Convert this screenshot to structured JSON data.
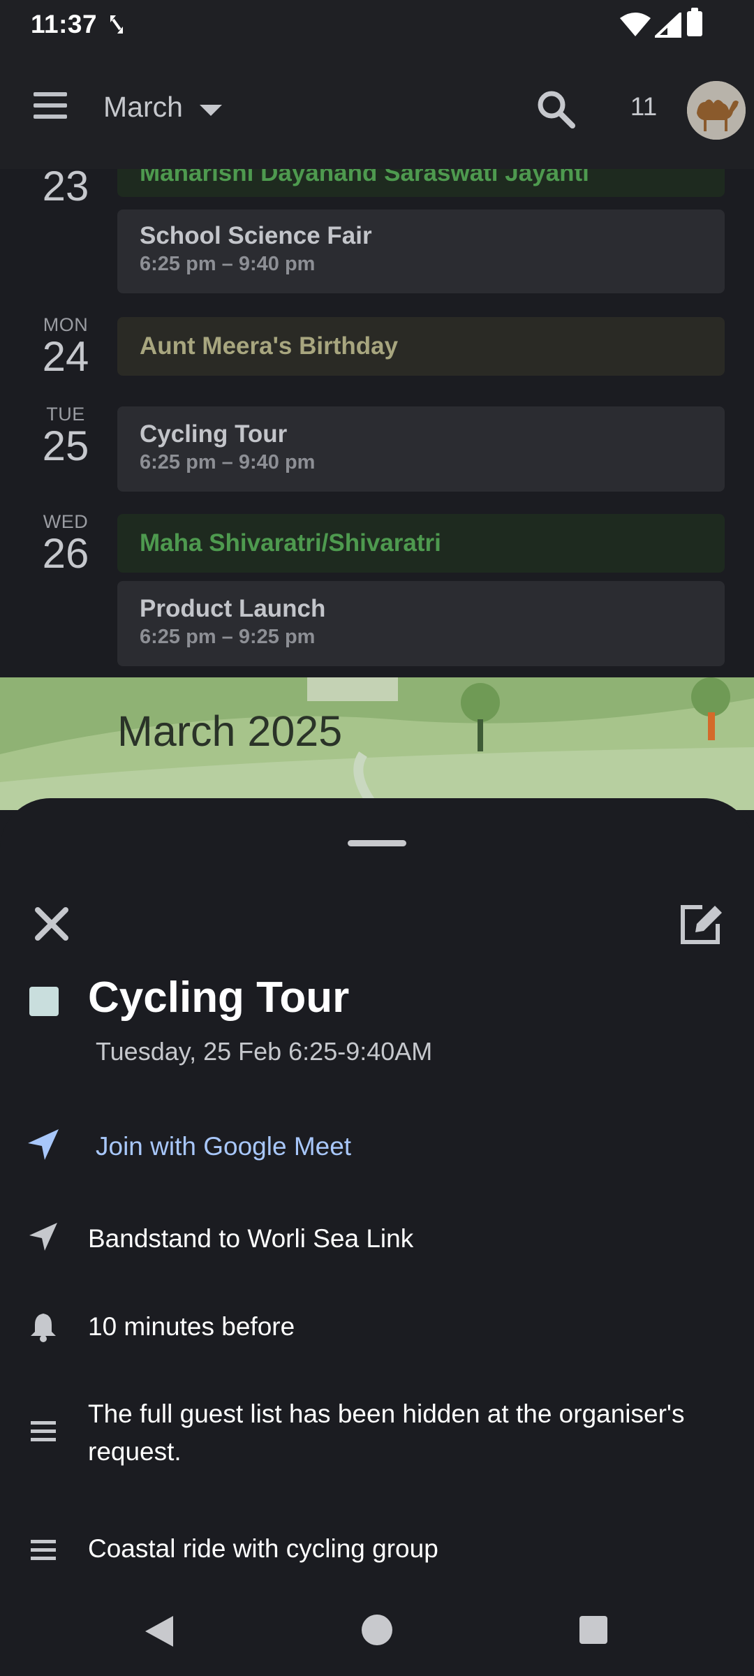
{
  "status_bar": {
    "time": "11:37"
  },
  "app_bar": {
    "month": "March",
    "today_day": "11"
  },
  "schedule": {
    "days": [
      {
        "dow": "",
        "num": "23",
        "events": [
          {
            "title": "Maharishi Dayanand Saraswati Jayanti",
            "time": "",
            "style": "holiday"
          },
          {
            "title": "School Science Fair",
            "time": "6:25 pm – 9:40 pm",
            "style": "event"
          }
        ]
      },
      {
        "dow": "MON",
        "num": "24",
        "events": [
          {
            "title": "Aunt Meera's Birthday",
            "time": "",
            "style": "birthday"
          }
        ]
      },
      {
        "dow": "TUE",
        "num": "25",
        "events": [
          {
            "title": "Cycling Tour",
            "time": "6:25 pm – 9:40 pm",
            "style": "event"
          }
        ]
      },
      {
        "dow": "WED",
        "num": "26",
        "events": [
          {
            "title": "Maha Shivaratri/Shivaratri",
            "time": "",
            "style": "holiday"
          },
          {
            "title": "Product Launch",
            "time": "6:25 pm – 9:25 pm",
            "style": "event"
          }
        ]
      }
    ]
  },
  "banner": {
    "title": "March 2025"
  },
  "sheet": {
    "event_title": "Cycling Tour",
    "event_date": "Tuesday, 25 Feb 6:25-9:40AM",
    "meet_label": "Join with Google Meet",
    "location": "Bandstand to Worli Sea Link",
    "reminder": "10 minutes before",
    "guests_note": "The full guest list has been hidden at the organiser's request.",
    "description": "Coastal ride with cycling group",
    "chip_color": "#c9dedd",
    "meet_color": "#a8c7fa"
  },
  "icons": {
    "menu": "menu-icon",
    "caret": "caret-down-icon",
    "search": "search-icon",
    "close": "close-icon",
    "edit": "edit-icon",
    "meet": "navigation-arrow-icon",
    "location": "location-arrow-icon",
    "bell": "bell-icon",
    "notes": "notes-lines-icon"
  }
}
